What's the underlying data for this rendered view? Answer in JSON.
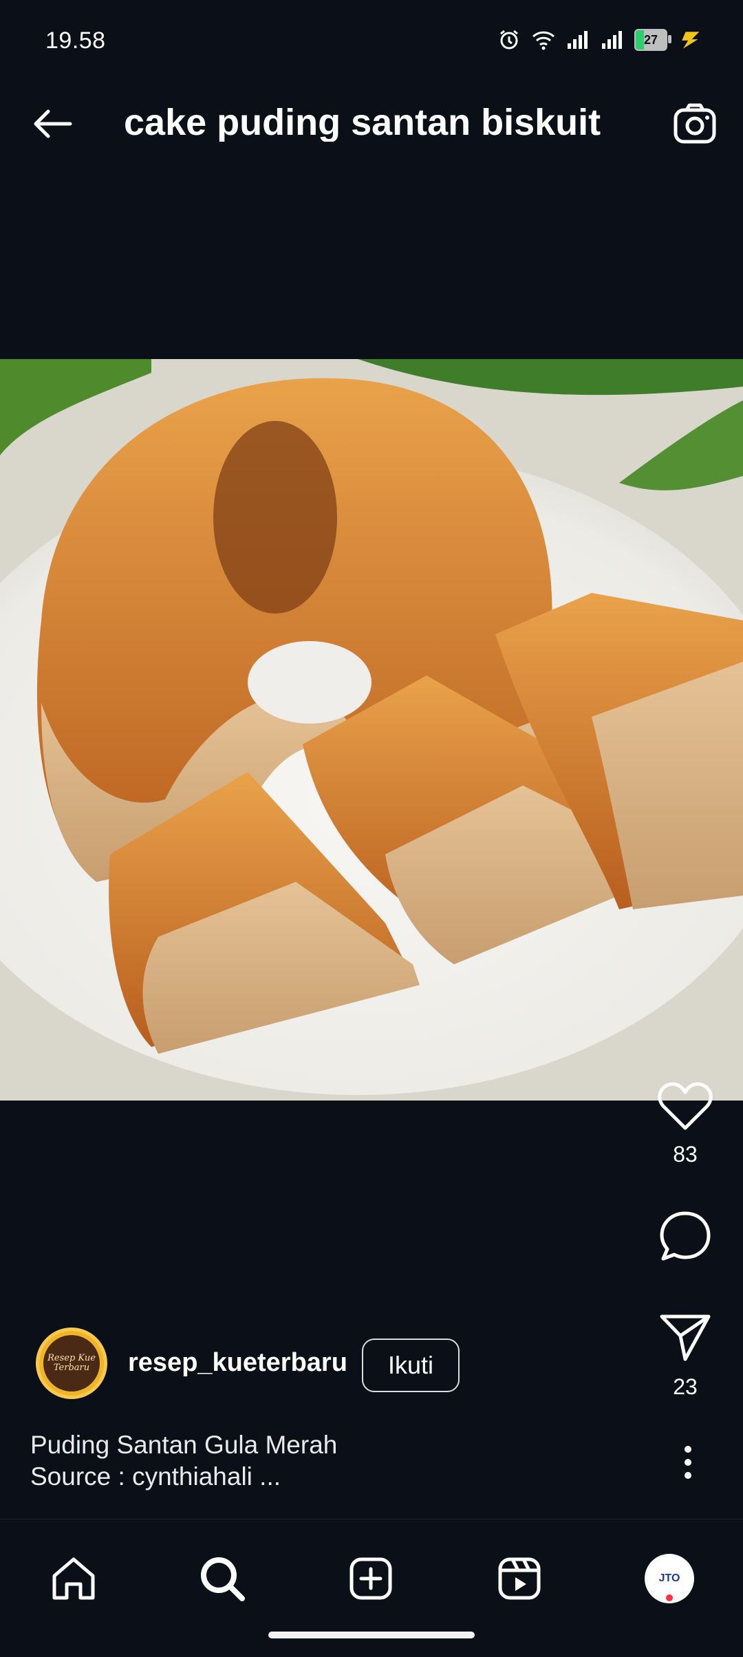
{
  "status_bar": {
    "time": "19.58",
    "battery": "27",
    "icons": [
      "alarm-icon",
      "wifi-icon",
      "signal-icon",
      "signal-icon",
      "battery-icon",
      "charging-icon"
    ]
  },
  "header": {
    "title": "cake puding santan biskuit"
  },
  "post": {
    "image_description_icon": "photo-of-layered-caramel-pudding-cake",
    "likes": "83",
    "shares": "23",
    "author": {
      "username": "resep_kueterbaru",
      "avatar_text": "Resep Kue Terbaru",
      "follow_label": "Ikuti"
    },
    "caption_line1": "Puding Santan Gula Merah",
    "caption_line2": "Source : cynthiahali ..."
  },
  "bottom_nav": {
    "items": [
      "home-icon",
      "search-icon",
      "create-icon",
      "reels-icon",
      "profile-avatar"
    ],
    "profile_avatar_text": "JTO"
  },
  "colors": {
    "background": "#0b0f17",
    "text": "#ffffff",
    "notification_dot": "#ff3040"
  }
}
